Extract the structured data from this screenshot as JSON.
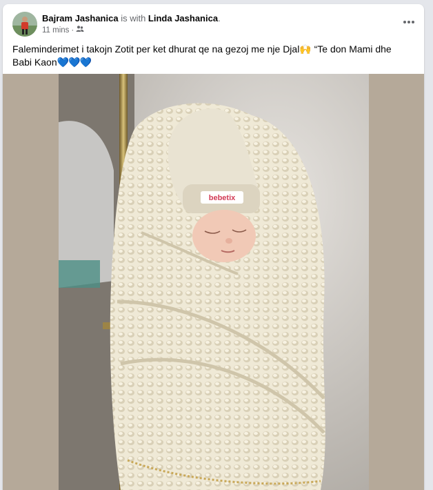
{
  "post": {
    "author": "Bajram Jashanica",
    "with_text": " is with ",
    "tagged": "Linda Jashanica",
    "period": ".",
    "time": "11 mins",
    "privacy_icon": "friends-icon",
    "more_icon": "more-options-icon",
    "caption_text": "Faleminderimet i takojn Zotit per ket dhurat qe na gezoj me nje Djal🙌 “Te don Mami dhe Babi Kaon",
    "caption_hearts": "💙💙💙",
    "photo_label": "bebetix"
  },
  "colors": {
    "background": "#e4e6eb",
    "card": "#ffffff",
    "text": "#050505",
    "secondary_text": "#65676b",
    "heart": "#2e9ce8",
    "photo_border": "#b5a999"
  }
}
